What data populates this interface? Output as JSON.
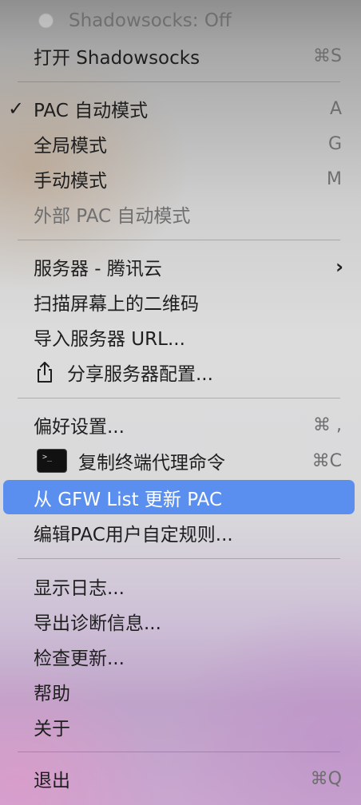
{
  "status": {
    "label": "Shadowsocks: Off"
  },
  "open": {
    "label": "打开 Shadowsocks",
    "shortcut": "⌘S"
  },
  "modes": [
    {
      "label": "PAC 自动模式",
      "shortcut": "A",
      "checked": "✓"
    },
    {
      "label": "全局模式",
      "shortcut": "G"
    },
    {
      "label": "手动模式",
      "shortcut": "M"
    },
    {
      "label": "外部 PAC 自动模式"
    }
  ],
  "server": {
    "label": "服务器 - 腾讯云",
    "arrow": "›"
  },
  "scan_qr": {
    "label": "扫描屏幕上的二维码"
  },
  "import_url": {
    "label": "导入服务器 URL..."
  },
  "share_config": {
    "label": "分享服务器配置..."
  },
  "preferences": {
    "label": "偏好设置...",
    "shortcut": "⌘ ,"
  },
  "copy_proxy": {
    "label": "复制终端代理命令",
    "shortcut": "⌘C"
  },
  "update_pac": {
    "label": "从 GFW List 更新 PAC"
  },
  "edit_pac": {
    "label": "编辑PAC用户自定规则..."
  },
  "show_log": {
    "label": "显示日志..."
  },
  "export_diag": {
    "label": "导出诊断信息..."
  },
  "check_update": {
    "label": "检查更新..."
  },
  "help": {
    "label": "帮助"
  },
  "about": {
    "label": "关于"
  },
  "quit": {
    "label": "退出",
    "shortcut": "⌘Q"
  },
  "colors": {
    "highlight": "#5a8ff0",
    "text": "#1e1e1e",
    "disabled": "#6f6f6f"
  }
}
